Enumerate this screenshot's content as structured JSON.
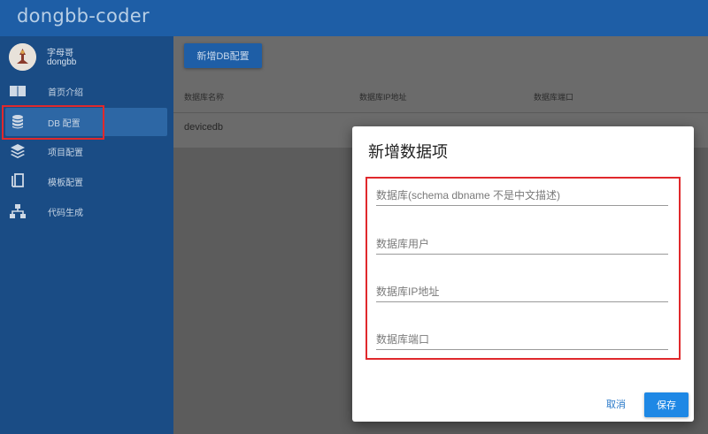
{
  "app": {
    "title": "dongbb-coder"
  },
  "user": {
    "name": "字母哥",
    "id": "dongbb"
  },
  "sidebar": {
    "items": [
      {
        "label": "首页介绍",
        "icon": "book-icon"
      },
      {
        "label": "DB 配置",
        "icon": "database-icon",
        "active": true
      },
      {
        "label": "项目配置",
        "icon": "layers-icon"
      },
      {
        "label": "模板配置",
        "icon": "copy-icon"
      },
      {
        "label": "代码生成",
        "icon": "sitemap-icon"
      }
    ]
  },
  "main": {
    "add_button": "新增DB配置",
    "columns": [
      "数据库名称",
      "数据库IP地址",
      "数据库端口"
    ],
    "rows": [
      {
        "name": "devicedb",
        "ip": "",
        "port": ""
      }
    ]
  },
  "dialog": {
    "title": "新增数据项",
    "fields": [
      {
        "placeholder": "数据库(schema dbname 不是中文描述)",
        "value": ""
      },
      {
        "placeholder": "数据库用户",
        "value": ""
      },
      {
        "placeholder": "数据库IP地址",
        "value": ""
      },
      {
        "placeholder": "数据库端口",
        "value": ""
      }
    ],
    "cancel_label": "取消",
    "save_label": "保存"
  },
  "colors": {
    "appbar": "#1e5ea6",
    "sidebar": "#1a4c85",
    "highlight": "#e0292c",
    "primary_button": "#1e88e5"
  }
}
